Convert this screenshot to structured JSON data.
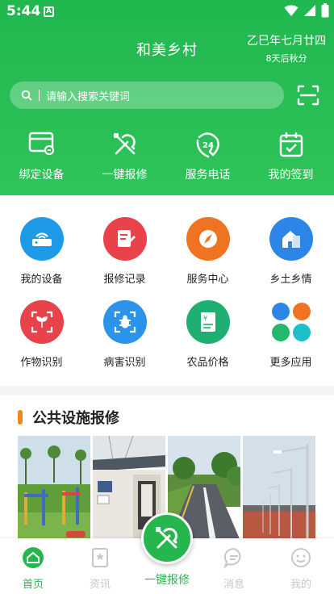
{
  "status_bar": {
    "time": "5:44",
    "notif_letter": "A"
  },
  "header": {
    "app_title": "和美乡村",
    "lunar_date": "乙巳年七月廿四",
    "solar_term": "8天后秋分",
    "search_placeholder": "请输入搜索关键词"
  },
  "quick_actions": [
    {
      "label": "绑定设备",
      "icon": "card-link-icon"
    },
    {
      "label": "一键报修",
      "icon": "repair-tools-icon"
    },
    {
      "label": "服务电话",
      "icon": "phone-24h-icon"
    },
    {
      "label": "我的签到",
      "icon": "calendar-check-icon"
    }
  ],
  "grid": [
    {
      "label": "我的设备",
      "icon": "router-icon",
      "color": "#1d9ae8"
    },
    {
      "label": "报修记录",
      "icon": "repair-record-icon",
      "color": "#e8424a"
    },
    {
      "label": "服务中心",
      "icon": "compass-icon",
      "color": "#f07322"
    },
    {
      "label": "乡土乡情",
      "icon": "house-icon",
      "color": "#2b86e8"
    },
    {
      "label": "作物识别",
      "icon": "plant-scan-icon",
      "color": "#e8424a"
    },
    {
      "label": "病害识别",
      "icon": "bug-scan-icon",
      "color": "#2b94e8"
    },
    {
      "label": "农品价格",
      "icon": "price-tag-icon",
      "color": "#1fb071"
    },
    {
      "label": "更多应用",
      "icon": "more-apps-icon",
      "color": "#2b86e8"
    }
  ],
  "section": {
    "title": "公共设施报修"
  },
  "tabbar": {
    "tabs": [
      {
        "label": "首页",
        "icon": "home-icon",
        "active": true
      },
      {
        "label": "资讯",
        "icon": "news-icon",
        "active": false
      },
      {
        "label": "消息",
        "icon": "message-icon",
        "active": false
      },
      {
        "label": "我的",
        "icon": "profile-icon",
        "active": false
      }
    ],
    "center_label": "一键报修"
  },
  "colors": {
    "primary": "#25b74e",
    "accent": "#f08a1c",
    "inactive": "#c8c8c8"
  }
}
